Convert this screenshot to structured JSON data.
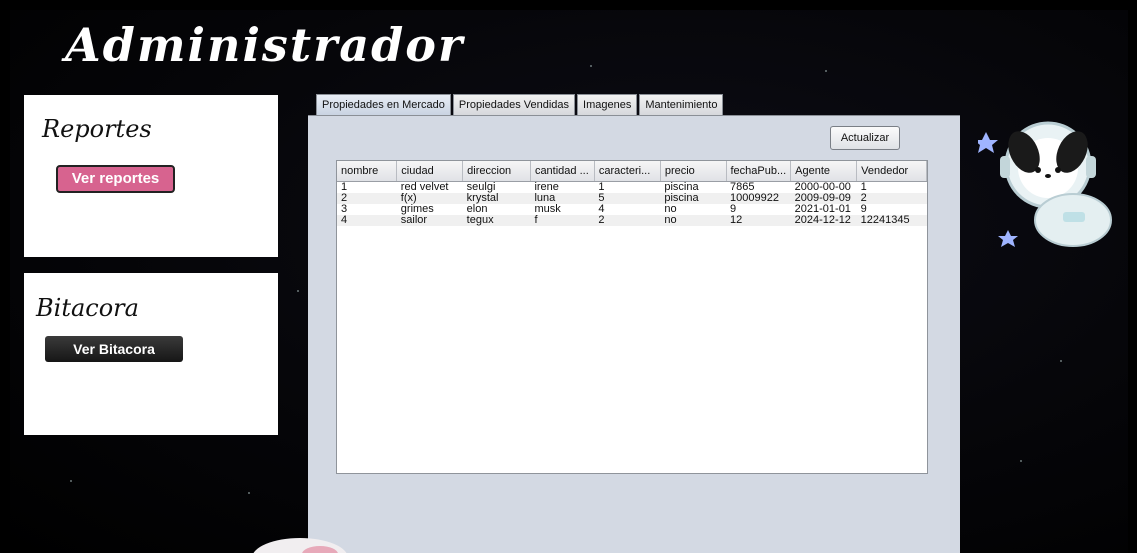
{
  "app": {
    "title": "Administrador"
  },
  "reportes": {
    "title": "Reportes",
    "button": "Ver reportes"
  },
  "bitacora": {
    "title": "Bitacora",
    "button": "Ver Bitacora"
  },
  "tabs": [
    {
      "label": "Propiedades en Mercado",
      "active": true
    },
    {
      "label": "Propiedades Vendidas",
      "active": false
    },
    {
      "label": "Imagenes",
      "active": false
    },
    {
      "label": "Mantenimiento",
      "active": false
    }
  ],
  "actualizar_label": "Actualizar",
  "table": {
    "columns": [
      "nombre",
      "ciudad",
      "direccion",
      "cantidad ...",
      "caracteri...",
      "precio",
      "fechaPub...",
      "Agente",
      "Vendedor"
    ],
    "rows": [
      [
        "1",
        "red velvet",
        "seulgi",
        "irene",
        "1",
        "piscina",
        "7865",
        "2000-00-00",
        "1"
      ],
      [
        "2",
        "f(x)",
        "krystal",
        "luna",
        "5",
        "piscina",
        "10009922",
        "2009-09-09",
        "2"
      ],
      [
        "3",
        "grimes",
        "elon",
        "musk",
        "4",
        "no",
        "9",
        "2021-01-01",
        "9"
      ],
      [
        "4",
        "sailor",
        "tegux",
        "f",
        "2",
        "no",
        "12",
        "2024-12-12",
        "12241345"
      ]
    ]
  },
  "colors": {
    "accent_pink": "#d7638f",
    "tab_bg": "#d3d9e3"
  }
}
